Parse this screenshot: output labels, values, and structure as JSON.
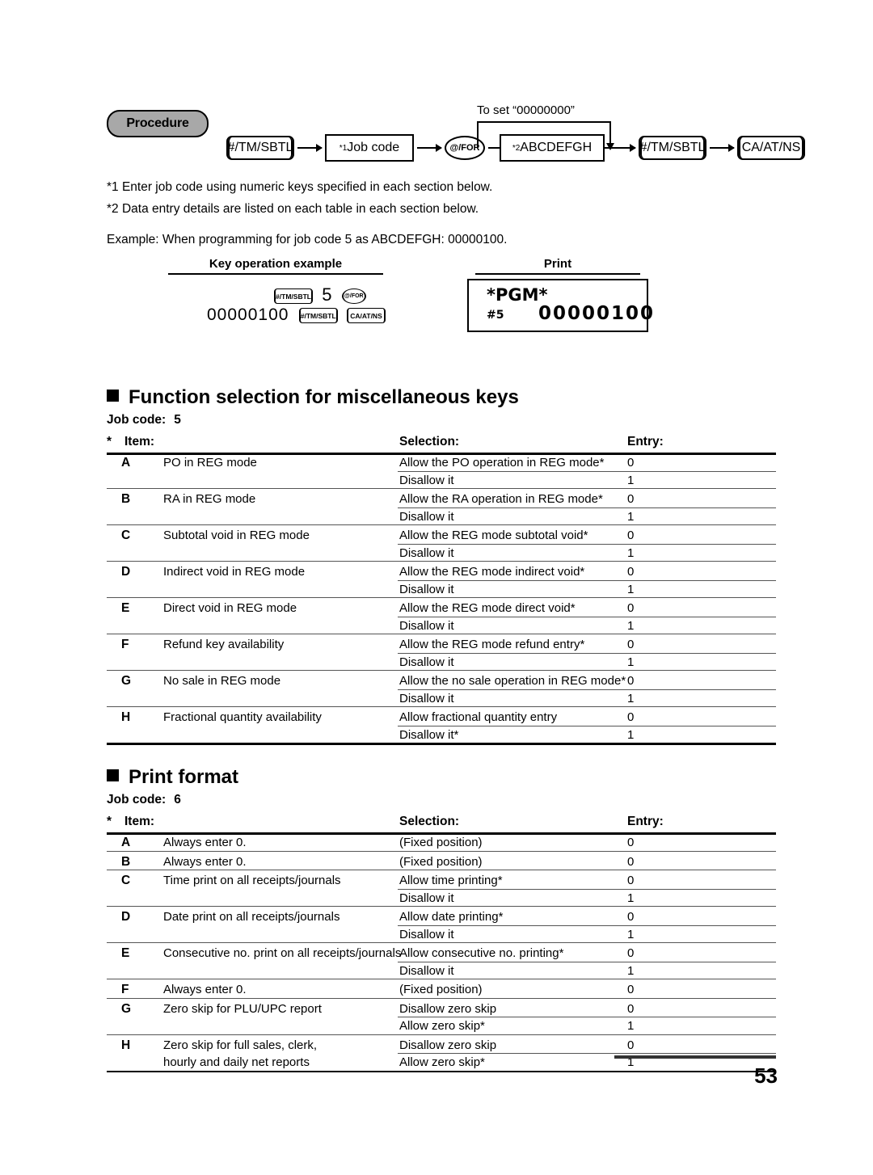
{
  "procedure": {
    "badge_label": "Procedure",
    "flow": {
      "step1_key": "#/TM/SBTL",
      "step2_box": "Job code",
      "step2_sup": "*1",
      "step3_key": "@/FOR",
      "step4_box": "ABCDEFGH",
      "step4_sup": "*2",
      "bypass_label": "To set “00000000”",
      "step5_key": "#/TM/SBTL",
      "step6_key": "CA/AT/NS"
    },
    "notes": [
      "*1  Enter job code using numeric keys specified in each section below.",
      "*2  Data entry details are listed on each table in each section below."
    ],
    "example_line": "Example:  When programming for job code 5 as ABCDEFGH: 00000100."
  },
  "example": {
    "key_operation_header": "Key operation example",
    "print_header": "Print",
    "keys": {
      "line1_key1": "#/TM/SBTL",
      "line1_digit": "5",
      "line1_key2": "@/FOR",
      "line2_number": "00000100",
      "line2_key1": "#/TM/SBTL",
      "line2_key2": "CA/AT/NS"
    },
    "print": {
      "title": "*PGM*",
      "job_label": "#5",
      "value": "00000100"
    }
  },
  "sections": [
    {
      "heading": "Function selection for miscellaneous keys",
      "job_code_label": "Job code:",
      "job_code_value": "5",
      "columns": {
        "star": "*",
        "item": "Item:",
        "selection": "Selection:",
        "entry": "Entry:"
      },
      "rows": [
        {
          "letter": "A",
          "item": "PO in REG mode",
          "options": [
            {
              "selection": "Allow the PO operation in REG mode*",
              "entry": "0"
            },
            {
              "selection": "Disallow it",
              "entry": "1"
            }
          ]
        },
        {
          "letter": "B",
          "item": "RA in REG mode",
          "options": [
            {
              "selection": "Allow the RA operation in REG mode*",
              "entry": "0"
            },
            {
              "selection": "Disallow it",
              "entry": "1"
            }
          ]
        },
        {
          "letter": "C",
          "item": "Subtotal void in REG mode",
          "options": [
            {
              "selection": "Allow the REG mode subtotal void*",
              "entry": "0"
            },
            {
              "selection": "Disallow it",
              "entry": "1"
            }
          ]
        },
        {
          "letter": "D",
          "item": "Indirect void in REG mode",
          "options": [
            {
              "selection": "Allow the REG mode indirect void*",
              "entry": "0"
            },
            {
              "selection": "Disallow it",
              "entry": "1"
            }
          ]
        },
        {
          "letter": "E",
          "item": "Direct void in REG mode",
          "options": [
            {
              "selection": "Allow the REG mode direct void*",
              "entry": "0"
            },
            {
              "selection": "Disallow it",
              "entry": "1"
            }
          ]
        },
        {
          "letter": "F",
          "item": "Refund key availability",
          "options": [
            {
              "selection": "Allow the REG mode refund entry*",
              "entry": "0"
            },
            {
              "selection": "Disallow it",
              "entry": "1"
            }
          ]
        },
        {
          "letter": "G",
          "item": "No sale in REG mode",
          "options": [
            {
              "selection": "Allow the no sale operation in REG mode*",
              "entry": "0"
            },
            {
              "selection": "Disallow it",
              "entry": "1"
            }
          ]
        },
        {
          "letter": "H",
          "item": "Fractional quantity availability",
          "options": [
            {
              "selection": "Allow fractional quantity entry",
              "entry": "0"
            },
            {
              "selection": "Disallow it*",
              "entry": "1"
            }
          ]
        }
      ]
    },
    {
      "heading": "Print format",
      "job_code_label": "Job code:",
      "job_code_value": "6",
      "columns": {
        "star": "*",
        "item": "Item:",
        "selection": "Selection:",
        "entry": "Entry:"
      },
      "rows": [
        {
          "letter": "A",
          "item": "Always enter 0.",
          "options": [
            {
              "selection": "(Fixed position)",
              "entry": "0"
            }
          ]
        },
        {
          "letter": "B",
          "item": "Always enter 0.",
          "options": [
            {
              "selection": "(Fixed position)",
              "entry": "0"
            }
          ]
        },
        {
          "letter": "C",
          "item": "Time print on all receipts/journals",
          "options": [
            {
              "selection": "Allow time printing*",
              "entry": "0"
            },
            {
              "selection": "Disallow it",
              "entry": "1"
            }
          ]
        },
        {
          "letter": "D",
          "item": "Date print on all receipts/journals",
          "options": [
            {
              "selection": "Allow date printing*",
              "entry": "0"
            },
            {
              "selection": "Disallow it",
              "entry": "1"
            }
          ]
        },
        {
          "letter": "E",
          "item": "Consecutive no. print on all receipts/journals",
          "options": [
            {
              "selection": "Allow consecutive no. printing*",
              "entry": "0"
            },
            {
              "selection": "Disallow it",
              "entry": "1"
            }
          ]
        },
        {
          "letter": "F",
          "item": "Always enter 0.",
          "options": [
            {
              "selection": "(Fixed position)",
              "entry": "0"
            }
          ]
        },
        {
          "letter": "G",
          "item": "Zero skip for PLU/UPC report",
          "options": [
            {
              "selection": "Disallow zero skip",
              "entry": "0"
            },
            {
              "selection": "Allow zero skip*",
              "entry": "1"
            }
          ]
        },
        {
          "letter": "H",
          "item": "Zero skip for full sales, clerk,",
          "item_line2": "hourly and daily net reports",
          "options": [
            {
              "selection": "Disallow zero skip",
              "entry": "0"
            },
            {
              "selection": "Allow zero skip*",
              "entry": "1"
            }
          ]
        }
      ]
    }
  ],
  "footer": {
    "page_number": "53"
  }
}
